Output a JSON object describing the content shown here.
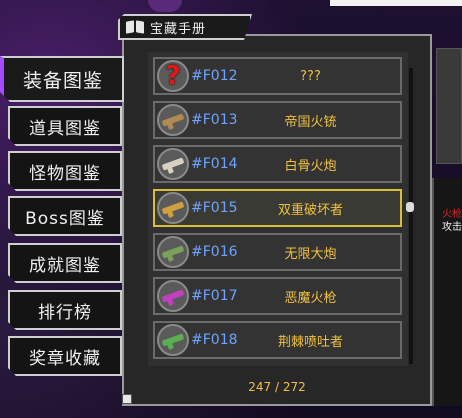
{
  "header": {
    "title": "宝藏手册"
  },
  "sidebar": {
    "tabs": [
      {
        "label": "装备图鉴",
        "active": true
      },
      {
        "label": "道具图鉴",
        "active": false
      },
      {
        "label": "怪物图鉴",
        "active": false
      },
      {
        "label": "Boss图鉴",
        "active": false
      },
      {
        "label": "成就图鉴",
        "active": false
      },
      {
        "label": "排行榜",
        "active": false
      },
      {
        "label": "奖章收藏",
        "active": false
      }
    ]
  },
  "items": [
    {
      "code": "#F012",
      "name": "???",
      "icon": "question-mark-icon",
      "icon_color": "#e01818"
    },
    {
      "code": "#F013",
      "name": "帝国火铳",
      "icon": "musket-icon",
      "icon_color": "#b08a50"
    },
    {
      "code": "#F014",
      "name": "白骨火炮",
      "icon": "bone-cannon-icon",
      "icon_color": "#d8d0c0"
    },
    {
      "code": "#F015",
      "name": "双重破坏者",
      "icon": "double-breaker-icon",
      "icon_color": "#d0a040",
      "selected": true
    },
    {
      "code": "#F016",
      "name": "无限大炮",
      "icon": "infinite-cannon-icon",
      "icon_color": "#7aa05a"
    },
    {
      "code": "#F017",
      "name": "恶魔火枪",
      "icon": "demon-gun-icon",
      "icon_color": "#c040c0"
    },
    {
      "code": "#F018",
      "name": "荆棘喷吐者",
      "icon": "thorn-spitter-icon",
      "icon_color": "#5ab050"
    }
  ],
  "counter": "247 / 272",
  "detail": {
    "line1": "火枪",
    "line2": "攻击"
  },
  "colors": {
    "accent": "#a24cff",
    "code_blue": "#6fa3ff",
    "name_gold": "#f0c040",
    "selected_border": "#d8c13a"
  }
}
